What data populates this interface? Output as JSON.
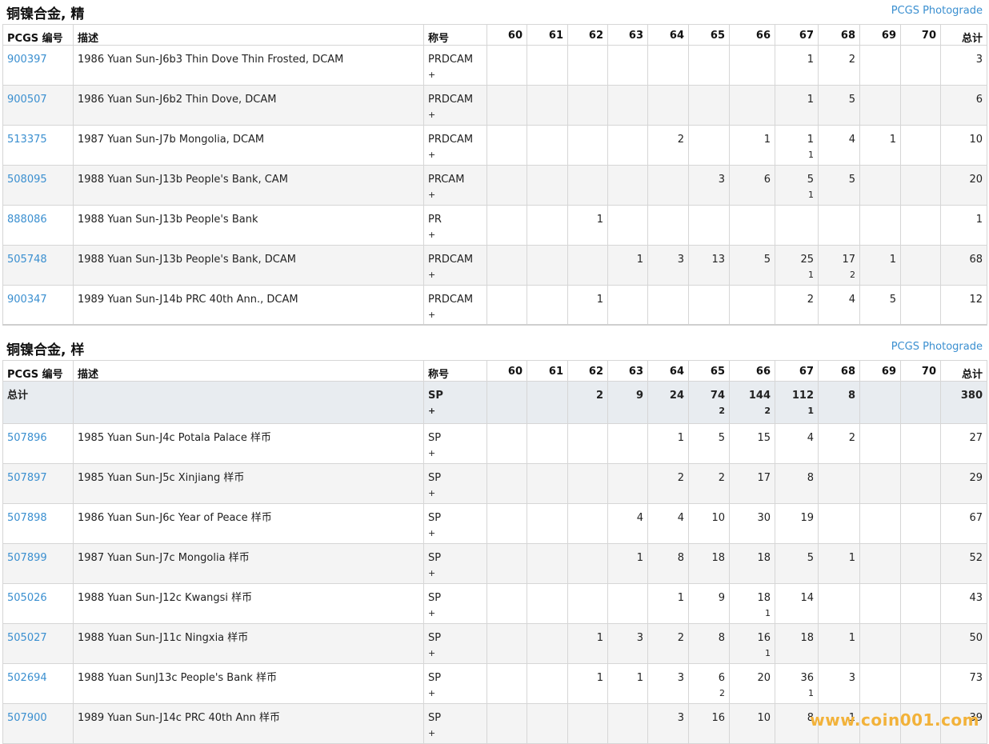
{
  "sections": [
    {
      "title": "铜镍合金, 精",
      "photograde_link": "PCGS Photograde",
      "headers": [
        "PCGS 编号",
        "描述",
        "称号",
        "60",
        "61",
        "62",
        "63",
        "64",
        "65",
        "66",
        "67",
        "68",
        "69",
        "70",
        "总计"
      ],
      "rows": [
        {
          "code": "900397",
          "desc": "1986 Yuan Sun-J6b3 Thin Dove Thin Frosted, DCAM",
          "designation": "PRDCAM",
          "plus": "+",
          "g60": "",
          "g61": "",
          "g62": "",
          "g63": "",
          "g64": "",
          "g65": "",
          "g66": "",
          "g67": "1",
          "g67b": "",
          "g68": "2",
          "g68b": "",
          "g69": "",
          "g70": "",
          "total": "3"
        },
        {
          "code": "900507",
          "desc": "1986 Yuan Sun-J6b2 Thin Dove, DCAM",
          "designation": "PRDCAM",
          "plus": "+",
          "g60": "",
          "g61": "",
          "g62": "",
          "g63": "",
          "g64": "",
          "g65": "",
          "g66": "",
          "g67": "1",
          "g67b": "",
          "g68": "5",
          "g68b": "",
          "g69": "",
          "g70": "",
          "total": "6"
        },
        {
          "code": "513375",
          "desc": "1987 Yuan Sun-J7b Mongolia, DCAM",
          "designation": "PRDCAM",
          "plus": "+",
          "g60": "",
          "g61": "",
          "g62": "",
          "g63": "",
          "g64": "2",
          "g65": "",
          "g66": "1",
          "g67": "1",
          "g67b": "1",
          "g68": "4",
          "g68b": "",
          "g69": "1",
          "g70": "",
          "total": "10"
        },
        {
          "code": "508095",
          "desc": "1988 Yuan Sun-J13b People's Bank, CAM",
          "designation": "PRCAM",
          "plus": "+",
          "g60": "",
          "g61": "",
          "g62": "",
          "g63": "",
          "g64": "",
          "g65": "3",
          "g66": "6",
          "g67": "5",
          "g67b": "1",
          "g68": "5",
          "g68b": "",
          "g69": "",
          "g70": "",
          "total": "20"
        },
        {
          "code": "888086",
          "desc": "1988 Yuan Sun-J13b People's Bank",
          "designation": "PR",
          "plus": "+",
          "g60": "",
          "g61": "",
          "g62": "1",
          "g63": "",
          "g64": "",
          "g65": "",
          "g66": "",
          "g67": "",
          "g67b": "",
          "g68": "",
          "g68b": "",
          "g69": "",
          "g70": "",
          "total": "1"
        },
        {
          "code": "505748",
          "desc": "1988 Yuan Sun-J13b People's Bank, DCAM",
          "designation": "PRDCAM",
          "plus": "+",
          "g60": "",
          "g61": "",
          "g62": "",
          "g63": "1",
          "g64": "3",
          "g65": "13",
          "g66": "5",
          "g67": "25",
          "g67b": "1",
          "g68": "17",
          "g68b": "2",
          "g69": "1",
          "g70": "",
          "total": "68"
        },
        {
          "code": "900347",
          "desc": "1989 Yuan Sun-J14b PRC 40th Ann., DCAM",
          "designation": "PRDCAM",
          "plus": "+",
          "g60": "",
          "g61": "",
          "g62": "1",
          "g63": "",
          "g64": "",
          "g65": "",
          "g66": "",
          "g67": "2",
          "g67b": "",
          "g68": "4",
          "g68b": "",
          "g69": "5",
          "g70": "",
          "total": "12"
        }
      ]
    },
    {
      "title": "铜镍合金, 样",
      "photograde_link": "PCGS Photograde",
      "headers": [
        "PCGS 编号",
        "描述",
        "称号",
        "60",
        "61",
        "62",
        "63",
        "64",
        "65",
        "66",
        "67",
        "68",
        "69",
        "70",
        "总计"
      ],
      "total_row": {
        "label": "总计",
        "designation": "SP",
        "plus": "+",
        "g60": "",
        "g61": "",
        "g62": "2",
        "g63": "9",
        "g64": "24",
        "g65": "74",
        "g65b": "2",
        "g66": "144",
        "g66b": "2",
        "g67": "112",
        "g67b": "1",
        "g68": "8",
        "g69": "",
        "g70": "",
        "total": "380"
      },
      "rows": [
        {
          "code": "507896",
          "desc": "1985 Yuan Sun-J4c Potala Palace 样币",
          "designation": "SP",
          "plus": "+",
          "g60": "",
          "g61": "",
          "g62": "",
          "g63": "",
          "g64": "1",
          "g65": "5",
          "g65b": "",
          "g66": "15",
          "g66b": "",
          "g67": "4",
          "g67b": "",
          "g68": "2",
          "g69": "",
          "g70": "",
          "total": "27"
        },
        {
          "code": "507897",
          "desc": "1985 Yuan Sun-J5c Xinjiang 样币",
          "designation": "SP",
          "plus": "+",
          "g60": "",
          "g61": "",
          "g62": "",
          "g63": "",
          "g64": "2",
          "g65": "2",
          "g65b": "",
          "g66": "17",
          "g66b": "",
          "g67": "8",
          "g67b": "",
          "g68": "",
          "g69": "",
          "g70": "",
          "total": "29"
        },
        {
          "code": "507898",
          "desc": "1986 Yuan Sun-J6c Year of Peace 样币",
          "designation": "SP",
          "plus": "+",
          "g60": "",
          "g61": "",
          "g62": "",
          "g63": "4",
          "g64": "4",
          "g65": "10",
          "g65b": "",
          "g66": "30",
          "g66b": "",
          "g67": "19",
          "g67b": "",
          "g68": "",
          "g69": "",
          "g70": "",
          "total": "67"
        },
        {
          "code": "507899",
          "desc": "1987 Yuan Sun-J7c Mongolia 样币",
          "designation": "SP",
          "plus": "+",
          "g60": "",
          "g61": "",
          "g62": "",
          "g63": "1",
          "g64": "8",
          "g65": "18",
          "g65b": "",
          "g66": "18",
          "g66b": "",
          "g67": "5",
          "g67b": "",
          "g68": "1",
          "g69": "",
          "g70": "",
          "total": "52"
        },
        {
          "code": "505026",
          "desc": "1988 Yuan Sun-J12c Kwangsi 样币",
          "designation": "SP",
          "plus": "+",
          "g60": "",
          "g61": "",
          "g62": "",
          "g63": "",
          "g64": "1",
          "g65": "9",
          "g65b": "",
          "g66": "18",
          "g66b": "1",
          "g67": "14",
          "g67b": "",
          "g68": "",
          "g69": "",
          "g70": "",
          "total": "43"
        },
        {
          "code": "505027",
          "desc": "1988 Yuan Sun-J11c Ningxia 样币",
          "designation": "SP",
          "plus": "+",
          "g60": "",
          "g61": "",
          "g62": "1",
          "g63": "3",
          "g64": "2",
          "g65": "8",
          "g65b": "",
          "g66": "16",
          "g66b": "1",
          "g67": "18",
          "g67b": "",
          "g68": "1",
          "g69": "",
          "g70": "",
          "total": "50"
        },
        {
          "code": "502694",
          "desc": "1988 Yuan SunJ13c People's Bank 样币",
          "designation": "SP",
          "plus": "+",
          "g60": "",
          "g61": "",
          "g62": "1",
          "g63": "1",
          "g64": "3",
          "g65": "6",
          "g65b": "2",
          "g66": "20",
          "g66b": "",
          "g67": "36",
          "g67b": "1",
          "g68": "3",
          "g69": "",
          "g70": "",
          "total": "73"
        },
        {
          "code": "507900",
          "desc": "1989 Yuan Sun-J14c PRC 40th Ann 样币",
          "designation": "SP",
          "plus": "+",
          "g60": "",
          "g61": "",
          "g62": "",
          "g63": "",
          "g64": "3",
          "g65": "16",
          "g65b": "",
          "g66": "10",
          "g66b": "",
          "g67": "8",
          "g67b": "",
          "g68": "1",
          "g69": "",
          "g70": "",
          "total": "39"
        }
      ]
    }
  ],
  "watermark": "www.coin001.com"
}
